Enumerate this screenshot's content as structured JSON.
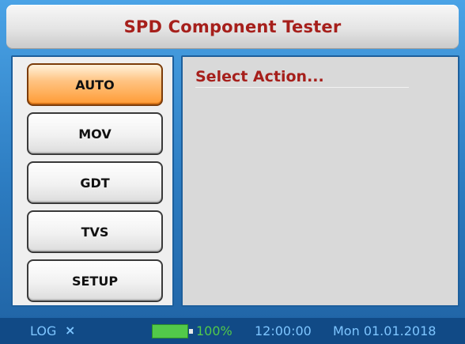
{
  "header": {
    "title": "SPD Component Tester"
  },
  "menu": {
    "items": [
      {
        "label": "AUTO",
        "active": true
      },
      {
        "label": "MOV",
        "active": false
      },
      {
        "label": "GDT",
        "active": false
      },
      {
        "label": "TVS",
        "active": false
      },
      {
        "label": "SETUP",
        "active": false
      }
    ]
  },
  "content": {
    "title": "Select Action..."
  },
  "status": {
    "log_label": "LOG",
    "log_close": "×",
    "battery_percent": "100%",
    "time": "12:00:00",
    "date": "Mon 01.01.2018"
  },
  "colors": {
    "accent_red": "#a61f1b",
    "active_orange": "#ff9b34",
    "battery_green": "#52c94a",
    "statusbar_bg": "#114a86"
  }
}
